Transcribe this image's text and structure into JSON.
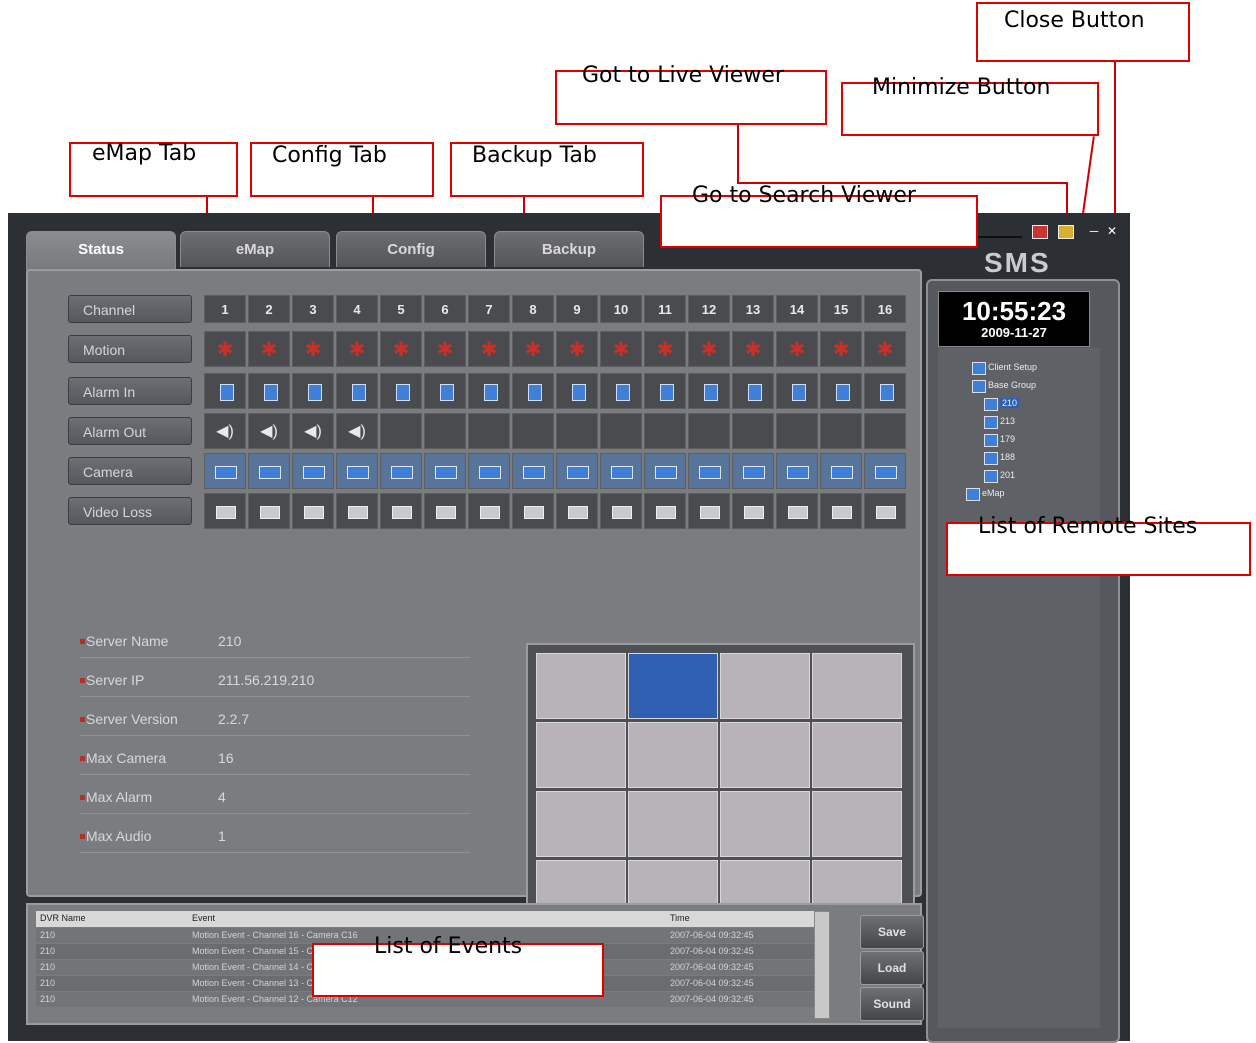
{
  "annotations": {
    "close": "Close Button",
    "live": "Got to Live Viewer",
    "minimize": "Minimize Button",
    "emap": "eMap Tab",
    "config": "Config Tab",
    "backup": "Backup Tab",
    "search": "Go to Search Viewer",
    "remote": "List of Remote Sites",
    "events": "List of Events"
  },
  "app_title": "SMS",
  "tabs": [
    "Status",
    "eMap",
    "Config",
    "Backup"
  ],
  "channel_rows": [
    "Channel",
    "Motion",
    "Alarm In",
    "Alarm Out",
    "Camera",
    "Video Loss"
  ],
  "channels": [
    "1",
    "2",
    "3",
    "4",
    "5",
    "6",
    "7",
    "8",
    "9",
    "10",
    "11",
    "12",
    "13",
    "14",
    "15",
    "16"
  ],
  "alarm_out_active_count": 4,
  "server_info": [
    {
      "label": "Server Name",
      "value": "210"
    },
    {
      "label": "Server IP",
      "value": "211.56.219.210"
    },
    {
      "label": "Server Version",
      "value": "2.2.7"
    },
    {
      "label": "Max Camera",
      "value": "16"
    },
    {
      "label": "Max Alarm",
      "value": "4"
    },
    {
      "label": "Max Audio",
      "value": "1"
    }
  ],
  "clock": {
    "time": "10:55:23",
    "date": "2009-11-27"
  },
  "tree": [
    {
      "label": "Client Setup"
    },
    {
      "label": "Base Group"
    },
    {
      "label": "210"
    },
    {
      "label": "213"
    },
    {
      "label": "179"
    },
    {
      "label": "188"
    },
    {
      "label": "201"
    },
    {
      "label": "eMap"
    }
  ],
  "events": {
    "columns": [
      "DVR Name",
      "Event",
      "Time"
    ],
    "rows": [
      {
        "dvr": "210",
        "event": "Motion Event - Channel 16 - Camera C16",
        "time": "2007-06-04 09:32:45"
      },
      {
        "dvr": "210",
        "event": "Motion Event - Channel 15 - Camera C15",
        "time": "2007-06-04 09:32:45"
      },
      {
        "dvr": "210",
        "event": "Motion Event - Channel 14 - Camera C14",
        "time": "2007-06-04 09:32:45"
      },
      {
        "dvr": "210",
        "event": "Motion Event - Channel 13 - Camera C13",
        "time": "2007-06-04 09:32:45"
      },
      {
        "dvr": "210",
        "event": "Motion Event - Channel 12 - Camera C12",
        "time": "2007-06-04 09:32:45"
      }
    ]
  },
  "buttons": {
    "save": "Save",
    "load": "Load",
    "sound": "Sound"
  },
  "colors": {
    "highlight": "#2f5fb0",
    "annotation": "#e00000",
    "motion": "#c8302a",
    "alarm": "#3f7fd8"
  }
}
